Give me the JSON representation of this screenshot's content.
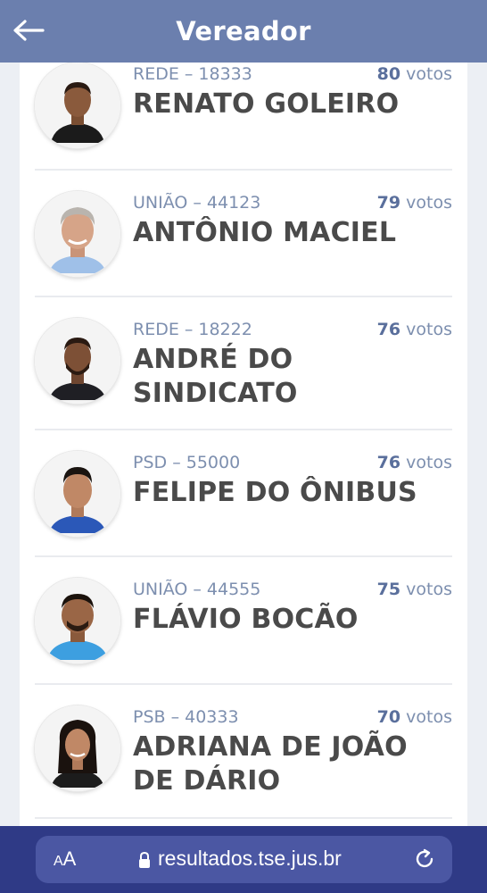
{
  "header": {
    "title": "Vereador",
    "back_icon": "arrow-left-icon"
  },
  "candidates": [
    {
      "party": "REDE – 18333",
      "votes": "80",
      "votes_label": "votos",
      "name": "RENATO GOLEIRO"
    },
    {
      "party": "UNIÃO – 44123",
      "votes": "79",
      "votes_label": "votos",
      "name": "ANTÔNIO MACIEL"
    },
    {
      "party": "REDE – 18222",
      "votes": "76",
      "votes_label": "votos",
      "name": "ANDRÉ DO SINDICATO"
    },
    {
      "party": "PSD – 55000",
      "votes": "76",
      "votes_label": "votos",
      "name": "FELIPE DO ÔNIBUS"
    },
    {
      "party": "UNIÃO – 44555",
      "votes": "75",
      "votes_label": "votos",
      "name": "FLÁVIO BOCÃO"
    },
    {
      "party": "PSB – 40333",
      "votes": "70",
      "votes_label": "votos",
      "name": "ADRIANA DE JOÃO DE DÁRIO"
    }
  ],
  "browser": {
    "text_size_label_big": "A",
    "text_size_label_small": "A",
    "url": "resultados.tse.jus.br",
    "lock_icon": "lock-icon",
    "reload_icon": "reload-icon"
  },
  "colors": {
    "header_bg": "#6b7fae",
    "accent_text": "#7d8faf",
    "votes_number": "#5a6f9c",
    "name_text": "#4a4a4a",
    "browser_bar": "#2f3a86"
  }
}
